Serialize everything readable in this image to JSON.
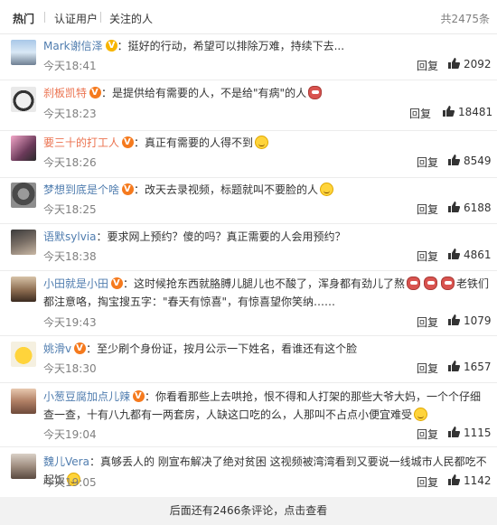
{
  "tabs": [
    {
      "label": "热门"
    },
    {
      "label": "认证用户"
    },
    {
      "label": "关注的人"
    }
  ],
  "total_label": "共2475条",
  "comments": [
    {
      "user": "Mark谢信泽",
      "badge": "gold",
      "text": "挺好的行动，希望可以排除万难，持续下去...",
      "time": "今天18:41",
      "reply": "回复",
      "likes": "2092"
    },
    {
      "user": "刹板凯特",
      "badge": "orange",
      "text": "是提供给有需要的人，不是给\"有病\"的人",
      "time": "今天18:23",
      "reply": "回复",
      "likes": "18481"
    },
    {
      "user": "要三十的打工人",
      "badge": "orange",
      "text": "真正有需要的人得不到",
      "time": "今天18:26",
      "reply": "回复",
      "likes": "8549"
    },
    {
      "user": "梦想到底是个啥",
      "badge": "orange",
      "text": "改天去录视频，标题就叫不要脸的人",
      "time": "今天18:25",
      "reply": "回复",
      "likes": "6188"
    },
    {
      "user": "语默sylvia",
      "badge": "",
      "text": "要求网上预约？傻的吗？真正需要的人会用预约？",
      "time": "今天18:38",
      "reply": "回复",
      "likes": "4861"
    },
    {
      "user": "小田就是小田",
      "badge": "orange",
      "text": "这时候抢东西就胳膊儿腿儿也不酸了，浑身都有劲儿了熬",
      "text2": "老铁们都注意咯，掏宝搜五字：\"春天有惊喜\"，有惊喜望你笑纳……",
      "time": "今天19:43",
      "reply": "回复",
      "likes": "1079"
    },
    {
      "user": "姚滑v",
      "badge": "orange",
      "text": "至少刷个身份证，按月公示一下姓名，看谁还有这个脸",
      "time": "今天18:30",
      "reply": "回复",
      "likes": "1657"
    },
    {
      "user": "小葱豆腐加点儿辣",
      "badge": "orange",
      "text": "你看看那些上去哄抢，恨不得和人打架的那些大爷大妈，一个个仔细查一查，十有八九都有一两套房，人缺这口吃的么，人那叫不占点小便宜难受",
      "time": "今天19:04",
      "reply": "回复",
      "likes": "1115"
    },
    {
      "user": "魏儿Vera",
      "badge": "",
      "text": "真够丢人的 刚宣布解决了绝对贫困 这视频被湾湾看到又要说一线城市人民都吃不起饭",
      "time": "今天19:05",
      "reply": "回复",
      "likes": "1142"
    }
  ],
  "more_label": "后面还有2466条评论，点击查看",
  "colors": {
    "username": "#eb7350",
    "meta": "#808080",
    "badge_gold": "#f7b500",
    "badge_orange": "#f57a1e"
  }
}
